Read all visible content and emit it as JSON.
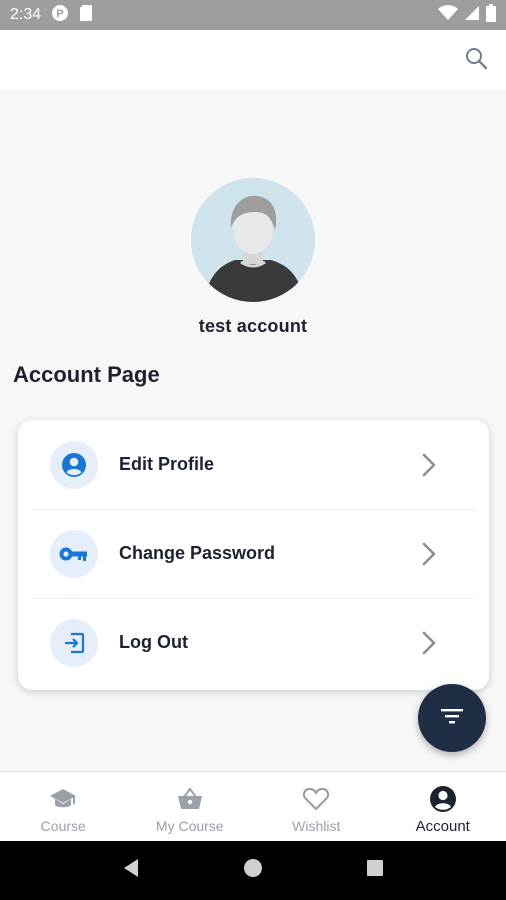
{
  "status_bar": {
    "time": "2:34"
  },
  "profile": {
    "name": "test account"
  },
  "section_title": "Account Page",
  "menu": [
    {
      "label": "Edit Profile",
      "icon": "account-circle-icon"
    },
    {
      "label": "Change Password",
      "icon": "key-icon"
    },
    {
      "label": "Log Out",
      "icon": "logout-icon"
    }
  ],
  "bottom_nav": [
    {
      "label": "Course",
      "icon": "graduation-cap-icon",
      "active": false
    },
    {
      "label": "My Course",
      "icon": "basket-icon",
      "active": false
    },
    {
      "label": "Wishlist",
      "icon": "heart-icon",
      "active": false
    },
    {
      "label": "Account",
      "icon": "account-circle-icon",
      "active": true
    }
  ],
  "colors": {
    "accent": "#1976d2",
    "text": "#1d2230",
    "fab": "#1f2e44",
    "inactive": "#9aa0a6"
  }
}
